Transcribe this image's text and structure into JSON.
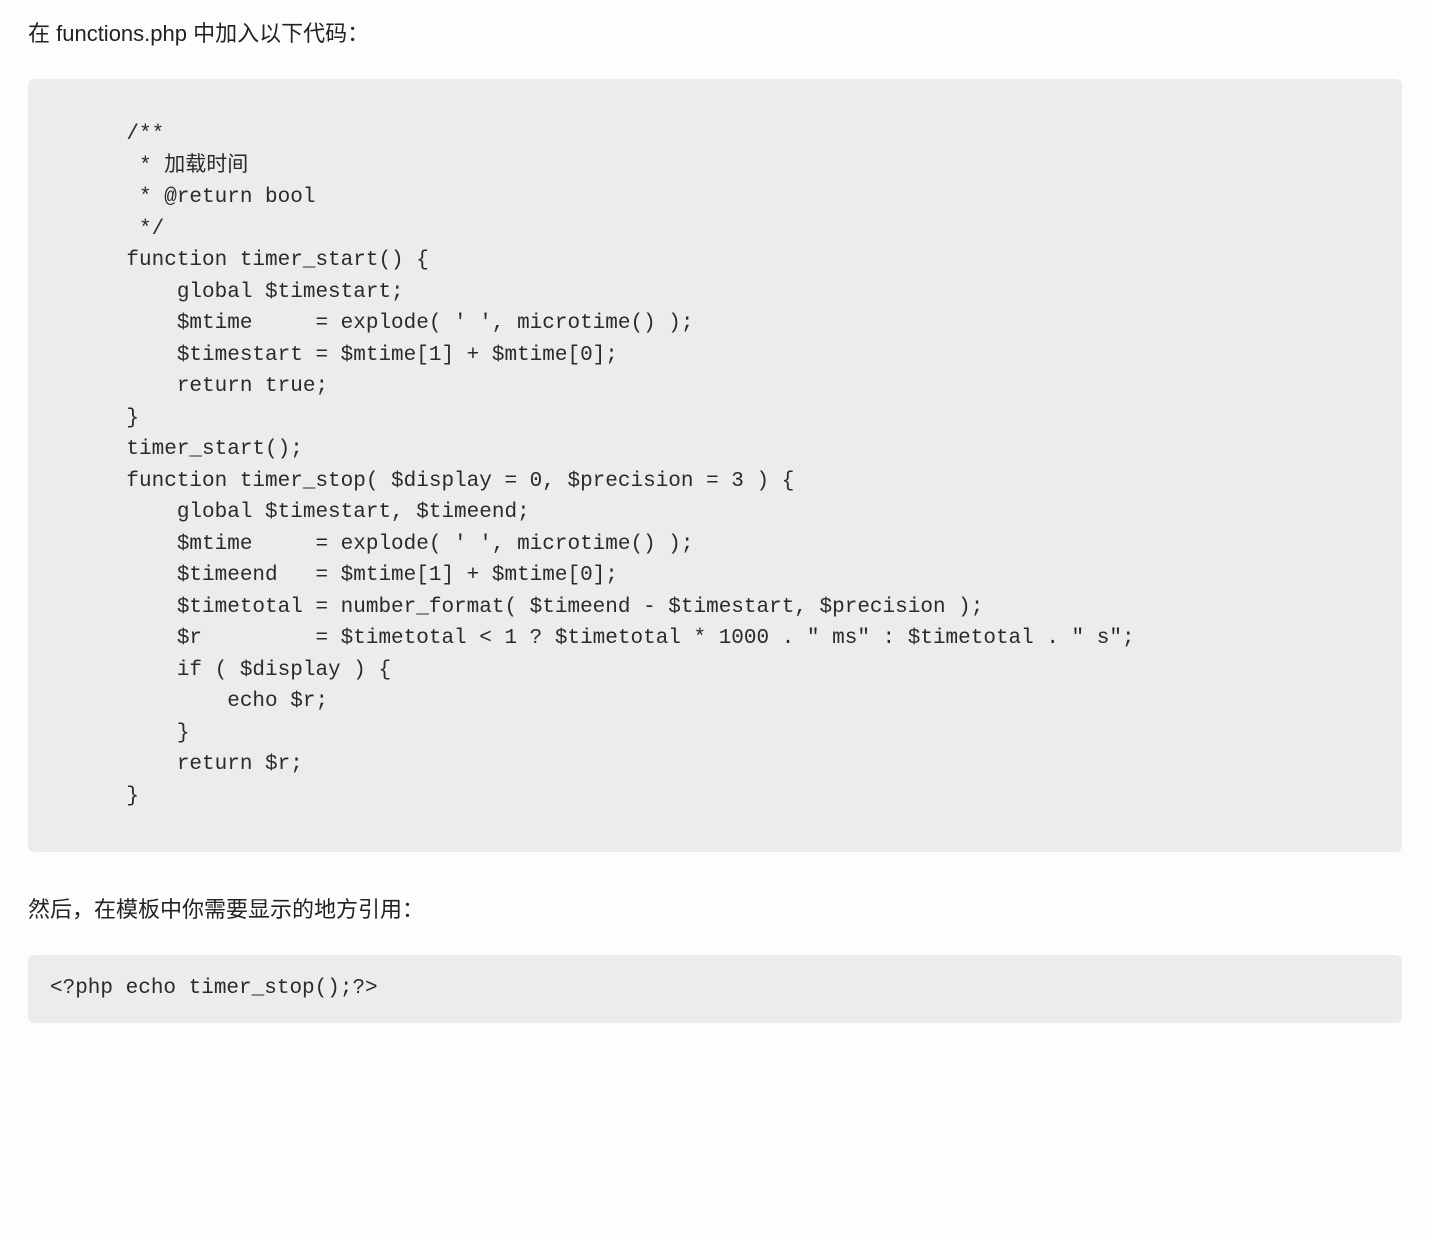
{
  "intro_text": "在 functions.php 中加入以下代码：",
  "code_block_1": "    /**\n     * 加载时间\n     * @return bool\n     */\n    function timer_start() {\n        global $timestart;\n        $mtime     = explode( ' ', microtime() );\n        $timestart = $mtime[1] + $mtime[0];\n        return true;\n    }\n    timer_start();\n    function timer_stop( $display = 0, $precision = 3 ) {\n        global $timestart, $timeend;\n        $mtime     = explode( ' ', microtime() );\n        $timeend   = $mtime[1] + $mtime[0];\n        $timetotal = number_format( $timeend - $timestart, $precision );\n        $r         = $timetotal < 1 ? $timetotal * 1000 . \" ms\" : $timetotal . \" s\";\n        if ( $display ) {\n            echo $r;\n        }\n        return $r;\n    }",
  "outro_text": "然后，在模板中你需要显示的地方引用：",
  "code_block_2": "<?php echo timer_stop();?>"
}
